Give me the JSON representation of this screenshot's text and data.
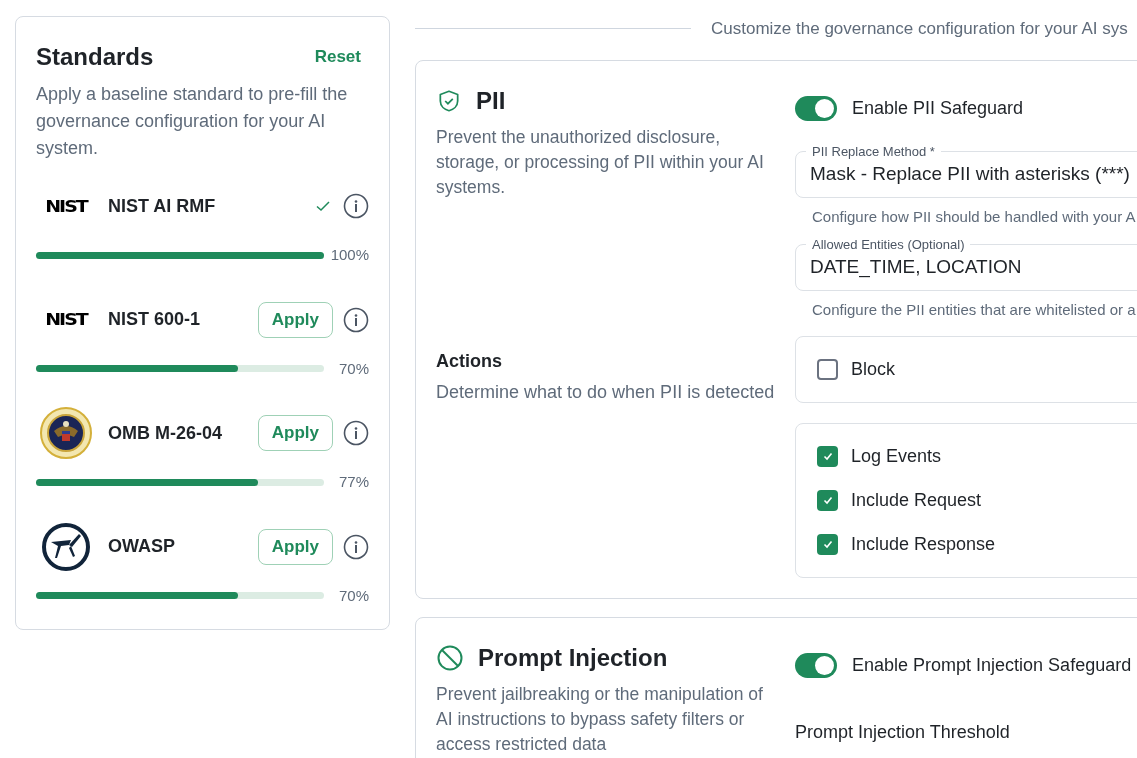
{
  "standards": {
    "title": "Standards",
    "reset": "Reset",
    "description": "Apply a baseline standard to pre-fill the governance configuration for your AI system.",
    "items": [
      {
        "name": "NIST AI RMF",
        "kind": "nist",
        "logo_text": "NIST",
        "applied": true,
        "level": 1.0,
        "reading": "100%"
      },
      {
        "name": "NIST 600-1",
        "kind": "nist",
        "logo_text": "NIST",
        "applied": false,
        "apply_label": "Apply",
        "level": 0.7,
        "reading": "70%"
      },
      {
        "name": "OMB M-26-04",
        "kind": "seal",
        "applied": false,
        "apply_label": "Apply",
        "level": 0.77,
        "reading": "77%"
      },
      {
        "name": "OWASP",
        "kind": "owasp",
        "applied": false,
        "apply_label": "Apply",
        "level": 0.7,
        "reading": "70%"
      }
    ]
  },
  "intro": "Customize the governance configuration for your AI sys",
  "sections": [
    {
      "kind": "pii",
      "title": "PII",
      "description": "Prevent the unauthorized disclosure, storage, or processing of PII within your AI systems.",
      "toggle": {
        "label": "Enable PII Safeguard",
        "on": true
      },
      "fields": [
        {
          "label": "PII Replace Method *",
          "value": "Mask - Replace PII with asterisks (***)",
          "help": "Configure how PII should be handled with your A"
        },
        {
          "label": "Allowed Entities (Optional)",
          "value": "DATE_TIME, LOCATION",
          "help": "Configure the PII entities that are whitelisted or a"
        }
      ],
      "actions": {
        "title": "Actions",
        "description": "Determine what to do when PII is detected",
        "groups": [
          [
            {
              "label": "Block",
              "checked": false
            }
          ],
          [
            {
              "label": "Log Events",
              "checked": true
            },
            {
              "label": "Include Request",
              "checked": true
            },
            {
              "label": "Include Response",
              "checked": true
            }
          ]
        ]
      }
    },
    {
      "kind": "prompt",
      "title": "Prompt Injection",
      "description": "Prevent jailbreaking or the manipulation of AI instructions to bypass safety filters or access restricted data",
      "toggle": {
        "label": "Enable Prompt Injection Safeguard",
        "on": true
      },
      "threshold_label": "Prompt Injection Threshold"
    }
  ]
}
